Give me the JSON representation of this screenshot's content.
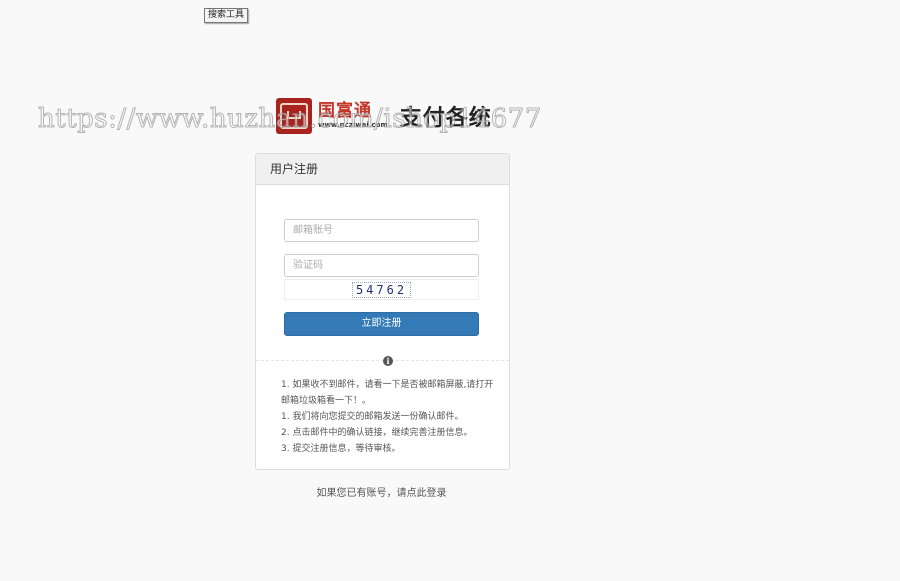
{
  "toolbar": {
    "search_tool_label": "搜索工具"
  },
  "logo": {
    "brand_cn": "国富通",
    "brand_url": "www.ncziwei.com",
    "calligraphy": "支付各统"
  },
  "watermark": "https://www.huzhan.com/ishop14677",
  "panel": {
    "title": "用户注册",
    "email_placeholder": "邮箱账号",
    "captcha_placeholder": "验证码",
    "captcha_code": "54762",
    "submit_label": "立即注册",
    "info_glyph": "i",
    "notes": [
      "1. 如果收不到邮件，请看一下是否被邮箱屏蔽,请打开邮箱垃圾箱看一下！。",
      "1. 我们将向您提交的邮箱发送一份确认邮件。",
      "2. 点击邮件中的确认链接，继续完善注册信息。",
      "3. 提交注册信息，等待审核。"
    ]
  },
  "login_link": "如果您已有账号，请点此登录",
  "colors": {
    "primary": "#337ab7",
    "brand_red": "#c5352a",
    "background": "#f9f9f9"
  }
}
